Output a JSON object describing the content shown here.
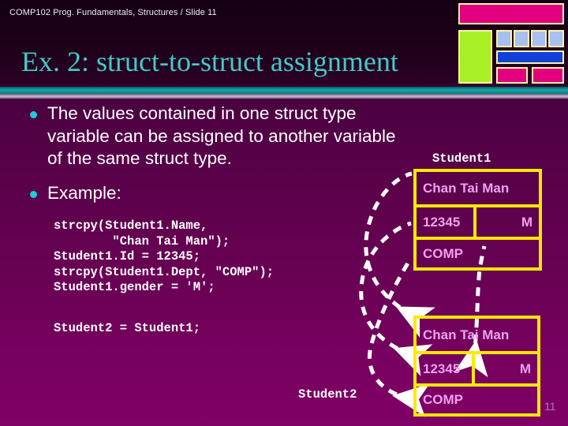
{
  "header": {
    "breadcrumb": "COMP102 Prog. Fundamentals, Structures / Slide 11"
  },
  "title": "Ex. 2: struct-to-struct assignment",
  "page_number": "11",
  "bullets": [
    {
      "text": "The values contained in one struct type\nvariable can be assigned to another variable\nof the same struct type."
    },
    {
      "text": "Example:"
    }
  ],
  "code": {
    "block1": "strcpy(Student1.Name,\n        \"Chan Tai Man\");\nStudent1.Id = 12345;\nstrcpy(Student1.Dept, \"COMP\");\nStudent1.gender = 'M';",
    "block2": "Student2 = Student1;"
  },
  "structs": [
    {
      "label": "Student1",
      "name": "Chan Tai Man",
      "id": "12345",
      "gender": "M",
      "dept": "COMP"
    },
    {
      "label": "Student2",
      "name": "Chan Tai Man",
      "id": "12345",
      "gender": "M",
      "dept": "COMP"
    }
  ],
  "decor": {
    "top_bar": "magenta-bar",
    "green_block": "green-block",
    "blue_squares": [
      "blue-square-1",
      "blue-square-2",
      "blue-square-3",
      "blue-square-4"
    ],
    "blue_bar": "blue-bar",
    "magenta_blocks": [
      "magenta-block-1",
      "magenta-block-2"
    ]
  },
  "colors": {
    "title": "#46c8c8",
    "bullet_dot": "#1ecbd6",
    "struct_border": "#ffe800",
    "struct_text": "#f0a0f0",
    "magenta": "#e2007f",
    "green": "#a8f024",
    "blue_square": "#a8c0f0",
    "blue_bar": "#1040d8",
    "deco_border": "#fbf3a8",
    "arrow": "#ffffff"
  }
}
